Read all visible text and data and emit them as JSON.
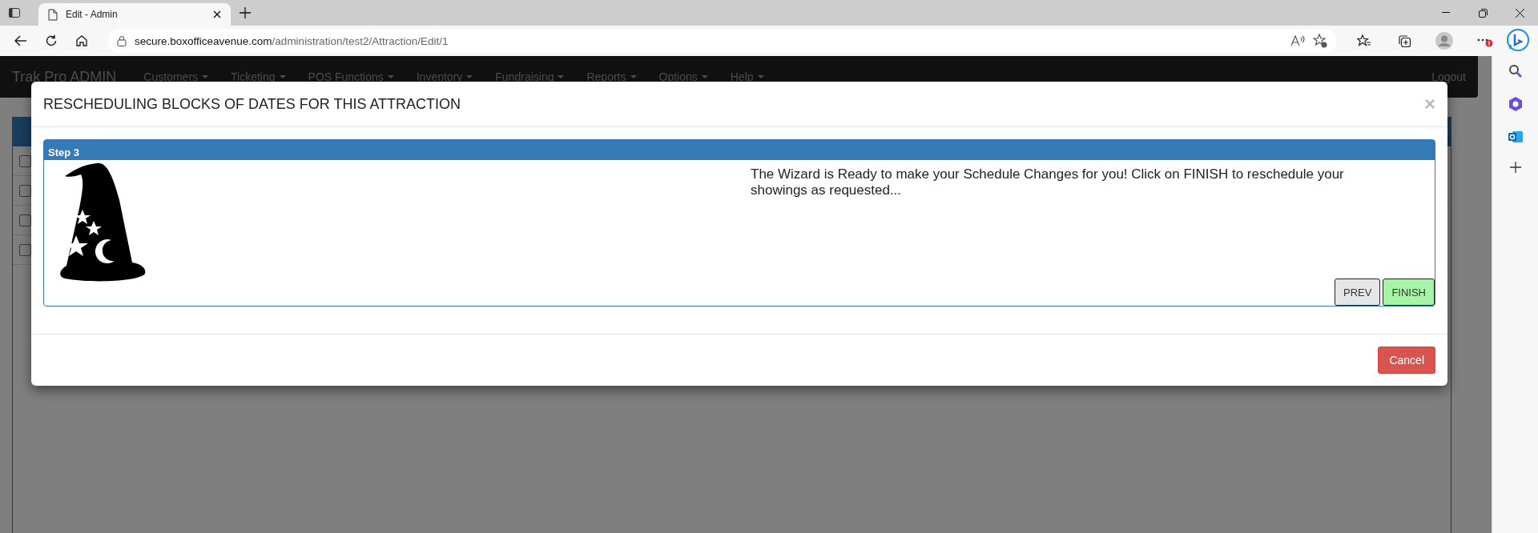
{
  "browser": {
    "tab": {
      "title": "Edit - Admin",
      "selected": true
    },
    "address": {
      "host": "secure.boxofficeavenue.com",
      "path": "/administration/test2/Attraction/Edit/1"
    }
  },
  "navbar": {
    "brand": "Trak Pro ADMIN",
    "menus": [
      "Customers",
      "Ticketing",
      "POS Functions",
      "Inventory",
      "Fundraising",
      "Reports",
      "Options",
      "Help"
    ],
    "logout": "Logout"
  },
  "background_rows": [
    {
      "checked": false
    },
    {
      "checked": false
    },
    {
      "checked": false
    },
    {
      "checked": false
    }
  ],
  "modal": {
    "title": "RESCHEDULING BLOCKS OF DATES FOR THIS ATTRACTION",
    "close": "×",
    "panel": {
      "header": "Step 3",
      "message": "The Wizard is Ready to make your Schedule Changes for you! Click on FINISH to reschedule your showings as requested...",
      "buttons": [
        {
          "label": "PREV",
          "kind": "default"
        },
        {
          "label": "FINISH",
          "kind": "success"
        }
      ]
    },
    "footer_buttons": [
      {
        "label": "Cancel",
        "kind": "danger"
      }
    ]
  }
}
